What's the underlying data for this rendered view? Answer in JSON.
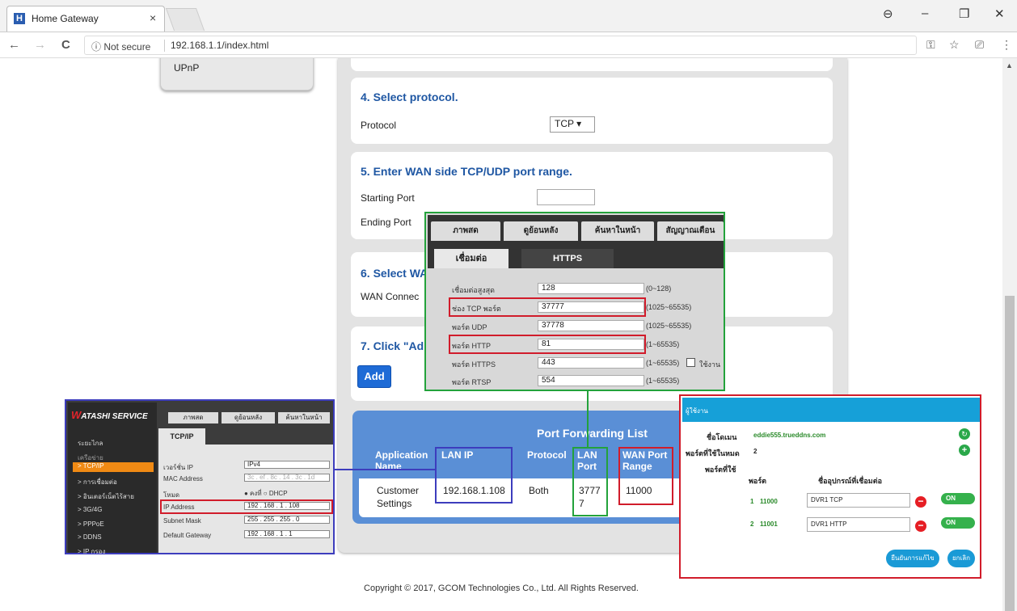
{
  "browser": {
    "tab_title": "Home Gateway",
    "tab_icon_letter": "H",
    "close": "×",
    "security_label": "ⓘ Not secure",
    "url": "192.168.1.1/index.html",
    "back": "←",
    "forward": "→",
    "reload": "C",
    "win_account": "⊖",
    "win_min": "–",
    "win_max": "❐",
    "win_close": "✕",
    "key_icon": "⚿",
    "star_icon": "☆",
    "cast_icon": "⎚",
    "menu_icon": "⋮"
  },
  "sidebar": {
    "item": "UPnP"
  },
  "sections": {
    "s4": {
      "title": "4. Select protocol.",
      "label": "Protocol",
      "value": "TCP ▾"
    },
    "s5": {
      "title": "5. Enter WAN side TCP/UDP port range.",
      "starting": "Starting Port",
      "ending": "Ending Port"
    },
    "s6": {
      "title": "6. Select WA",
      "label": "WAN Connec"
    },
    "s7": {
      "title": "7. Click \"Ad",
      "button": "Add"
    }
  },
  "port_forwarding": {
    "title": "Port Forwarding List",
    "headers": [
      "Application Name",
      "LAN IP",
      "Protocol",
      "LAN Port",
      "WAN Port Range"
    ],
    "row": {
      "app_line1": "Customer",
      "app_line2": "Settings",
      "lan_ip": "192.168.1.108",
      "protocol": "Both",
      "lan_port_line1": "3777",
      "lan_port_line2": "7",
      "wan_range": "11000"
    }
  },
  "dvr": {
    "tabs": [
      "ภาพสด",
      "ดูย้อนหลัง",
      "ค้นหาในหน้า",
      "สัญญาณเตือน"
    ],
    "subtabs": [
      "เชื่อมต่อ",
      "HTTPS"
    ],
    "rows": [
      {
        "label": "เชื่อมต่อสูงสุด",
        "value": "128",
        "range": "(0~128)"
      },
      {
        "label": "ช่อง TCP พอร์ต",
        "value": "37777",
        "range": "(1025~65535)"
      },
      {
        "label": "พอร์ต UDP",
        "value": "37778",
        "range": "(1025~65535)"
      },
      {
        "label": "พอร์ต HTTP",
        "value": "81",
        "range": "(1~65535)"
      },
      {
        "label": "พอร์ต HTTPS",
        "value": "443",
        "range": "(1~65535)"
      },
      {
        "label": "พอร์ต RTSP",
        "value": "554",
        "range": "(1~65535)"
      }
    ],
    "enable_label": "ใช้งาน"
  },
  "watashi": {
    "logo": "ATASHI SERVICE",
    "logo_w": "W",
    "tabs": [
      "ภาพสด",
      "ดูย้อนหลัง",
      "ค้นหาในหน้า"
    ],
    "subtab": "TCP/IP",
    "menu": [
      "ระยะไกล",
      "เครือข่าย",
      "> TCP/IP",
      "> การเชื่อมต่อ",
      "> อินเตอร์เน็ตไร้สาย",
      "> 3G/4G",
      "> PPPoE",
      "> DDNS",
      "> IP กรอง"
    ],
    "fields": [
      {
        "label": "เวอร์ชั่น IP",
        "value": "IPv4"
      },
      {
        "label": "MAC Address",
        "value": "3c . ef . 8c . 14 . 3c . 1d"
      },
      {
        "label": "โหมด",
        "value": "● คงที่    ○ DHCP"
      },
      {
        "label": "IP Address",
        "value": "192 . 168 . 1 . 108"
      },
      {
        "label": "Subnet Mask",
        "value": "255 . 255 . 255 . 0"
      },
      {
        "label": "Default Gateway",
        "value": "192 . 168 . 1 . 1"
      }
    ]
  },
  "ddns": {
    "header": "ผู้ใช้งาน",
    "domain_label": "ชื่อโดเมน",
    "domain_value": "eddie555.trueddns.com",
    "ports_label": "พอร์ตที่ใช้ในหมด",
    "ports_value": "2",
    "usable_label": "พอร์ตที่ใช้",
    "col_port": "พอร์ต",
    "col_device": "ชื่ออุปกรณ์ที่เชื่อมต่อ",
    "rows": [
      {
        "idx": "1",
        "port": "11000",
        "device": "DVR1 TCP",
        "toggle": "ON"
      },
      {
        "idx": "2",
        "port": "11001",
        "device": "DVR1 HTTP",
        "toggle": "ON"
      }
    ],
    "confirm": "ยืนยันการแก้ไข",
    "cancel": "ยกเลิก"
  },
  "footer": {
    "copyright": "Copyright © 2017, GCOM Technologies Co., Ltd. All Rights Reserved."
  },
  "colors": {
    "link_blue": "#1f57a3",
    "panel_blue": "#5a8fd6",
    "highlight_red": "#d11c2b",
    "highlight_green": "#23a23b",
    "highlight_blue": "#3d3dbd"
  }
}
